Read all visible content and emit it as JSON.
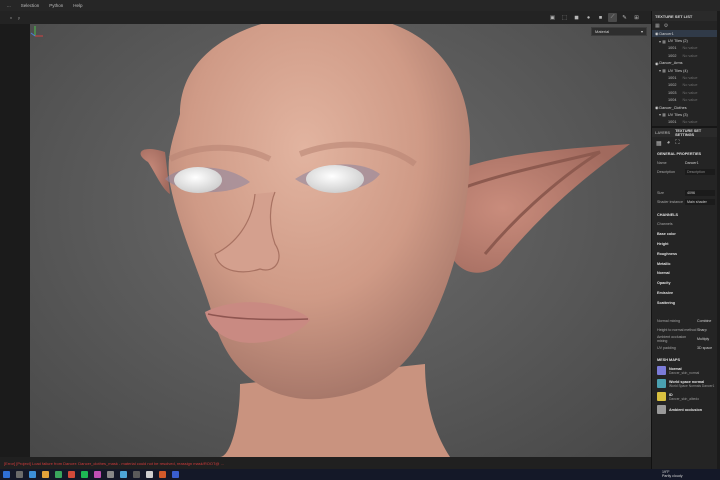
{
  "menu": [
    "...",
    "Selection",
    "Python",
    "Help"
  ],
  "toolbar": {
    "left": [
      "x",
      "y"
    ]
  },
  "viewport": {
    "dropdown": "Material",
    "dropdown_arrow": "▾"
  },
  "console_line": "[Error] [Project] Load failure from Dancer: Dancer_clothes_mask - material could not be resolved, reassign mask/ROOT@ ...",
  "panel": {
    "texture_set_list_title": "TEXTURE SET LIST",
    "sets": [
      {
        "name": "Dancer1",
        "uv": "UV Tiles (2)",
        "tiles": [
          "1001",
          "1002"
        ]
      },
      {
        "name": "Dancer_Arms",
        "uv": "UV Tiles (4)",
        "tiles": [
          "1001",
          "1002",
          "1003",
          "1004"
        ]
      },
      {
        "name": "Dancer_Clothes",
        "uv": "UV Tiles (3)",
        "tiles": [
          "1001"
        ]
      }
    ],
    "no_value": "No value",
    "tabs": {
      "layers": "LAYERS",
      "settings": "TEXTURE SET SETTINGS"
    },
    "general_title": "GENERAL PROPERTIES",
    "props": [
      {
        "k": "Name",
        "v": "Dancer1"
      },
      {
        "k": "Description",
        "v": "Description"
      }
    ],
    "size": {
      "k": "Size",
      "v": "4096"
    },
    "shader": {
      "k": "Shader instance",
      "v": "Main shader"
    },
    "channels_title": "CHANNELS",
    "channels_head": "Channels",
    "channels": [
      "Base color",
      "Height",
      "Roughness",
      "Metallic",
      "Normal",
      "Opacity",
      "Emissive",
      "Scattering"
    ],
    "extra": [
      {
        "k": "Normal mixing",
        "v": "Combine"
      },
      {
        "k": "Height to normal method",
        "v": "Sharp"
      },
      {
        "k": "Ambient occlusion mixing",
        "v": "Multiply"
      },
      {
        "k": "UV padding",
        "v": "3D space"
      }
    ],
    "mesh_title": "MESH MAPS",
    "mesh_maps": [
      {
        "t1": "Normal",
        "t2": "Dancer_skin_normal",
        "color": "#7b7bd8"
      },
      {
        "t1": "World space normal",
        "t2": "World Space Normals Dancer1",
        "color": "#4aa0b0"
      },
      {
        "t1": "ID",
        "t2": "Dancer_skin_albedo",
        "color": "#d8c040"
      },
      {
        "t1": "Ambient occlusion",
        "t2": "",
        "color": "#9a9a9a"
      }
    ]
  },
  "tray": {
    "temp": "19°F",
    "weather": "Partly cloudy",
    "right": "Carte C..."
  },
  "colors": {
    "accent": "#4a8fd4",
    "error": "#d23b3b",
    "skin": "#d7a691"
  }
}
